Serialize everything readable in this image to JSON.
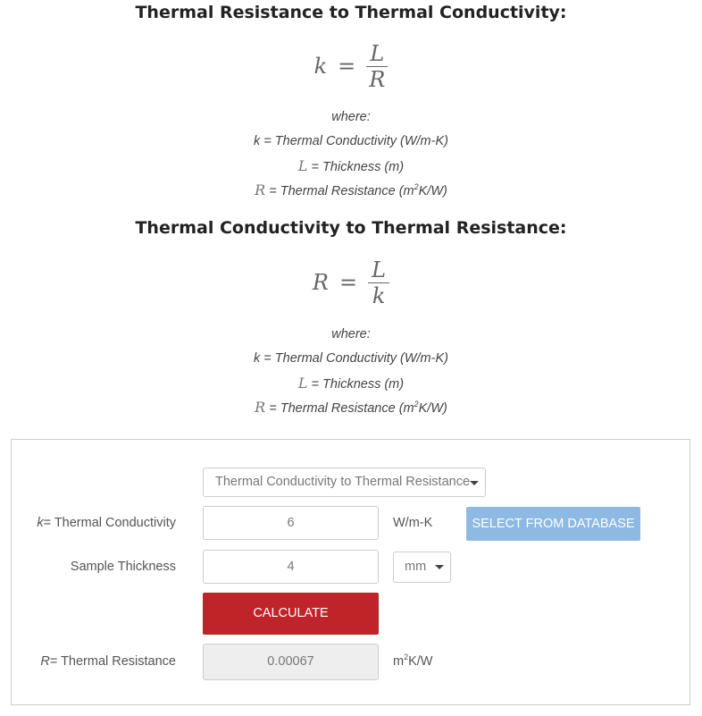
{
  "section1": {
    "title": "Thermal Resistance to Thermal Conductivity:",
    "formula": {
      "lhs": "k",
      "eq": "=",
      "numerator": "L",
      "denominator": "R"
    },
    "where_label": "where:",
    "definitions": [
      {
        "symbol": "k",
        "text": " = Thermal Conductivity (W/m-K)"
      },
      {
        "symbol": "L",
        "text": " = Thickness (m)"
      },
      {
        "symbol": "R",
        "text": " = Thermal Resistance (m",
        "sup": "2",
        "tail": "K/W)"
      }
    ]
  },
  "section2": {
    "title": "Thermal Conductivity to Thermal Resistance:",
    "formula": {
      "lhs": "R",
      "eq": "=",
      "numerator": "L",
      "denominator": "k"
    },
    "where_label": "where:",
    "definitions": [
      {
        "symbol": "k",
        "text": " = Thermal Conductivity (W/m-K)"
      },
      {
        "symbol": "L",
        "text": " = Thickness (m)"
      },
      {
        "symbol": "R",
        "text": " = Thermal Resistance (m",
        "sup": "2",
        "tail": "K/W)"
      }
    ]
  },
  "calculator": {
    "mode_select": "Thermal Conductivity to Thermal Resistance",
    "conductivity": {
      "symbol": "k",
      "label": "= Thermal Conductivity",
      "value": "6",
      "unit": "W/m-K"
    },
    "database_button": "SELECT FROM DATABASE",
    "thickness": {
      "label": "Sample Thickness",
      "value": "4",
      "unit": "mm"
    },
    "calculate_button": "CALCULATE",
    "result": {
      "symbol": "R",
      "label": "= Thermal Resistance",
      "value": "0.00067",
      "unit_base": "m",
      "unit_sup": "2",
      "unit_tail": "K/W"
    }
  }
}
